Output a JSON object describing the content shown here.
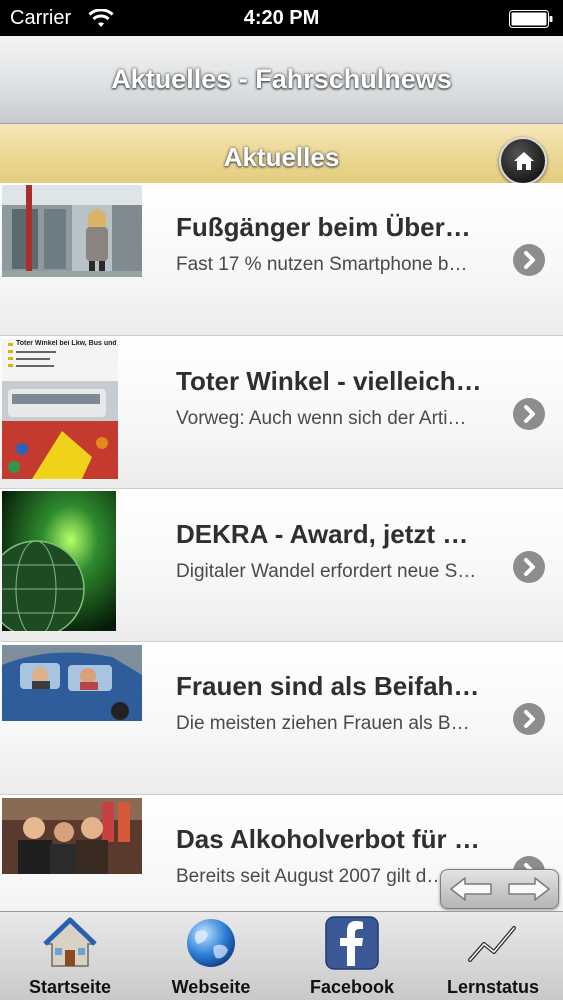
{
  "status_bar": {
    "carrier": "Carrier",
    "time": "4:20 PM"
  },
  "nav": {
    "title": "Aktuelles - Fahrschulnews"
  },
  "section": {
    "title": "Aktuelles"
  },
  "news": [
    {
      "headline": "Fußgänger beim Über…",
      "teaser": "Fast 17 % nutzen Smartphone b…"
    },
    {
      "headline": "Toter Winkel - vielleich…",
      "teaser": "Vorweg: Auch wenn sich der Arti…",
      "thumb_caption": "Toter Winkel bei Lkw, Bus und Pkw"
    },
    {
      "headline": "DEKRA - Award, jetzt …",
      "teaser": "Digitaler Wandel erfordert neue S…"
    },
    {
      "headline": "Frauen sind als Beifah…",
      "teaser": "Die meisten ziehen Frauen als B…"
    },
    {
      "headline": "Das Alkoholverbot für …",
      "teaser": "Bereits seit August 2007 gilt d…"
    }
  ],
  "tabs": [
    {
      "label": "Startseite",
      "icon": "house-icon"
    },
    {
      "label": "Webseite",
      "icon": "globe-icon"
    },
    {
      "label": "Facebook",
      "icon": "facebook-icon"
    },
    {
      "label": "Lernstatus",
      "icon": "chart-line-icon"
    }
  ],
  "colors": {
    "section_gold": "#ecd895",
    "facebook_blue": "#3b5998",
    "chevron_gray": "#8d8d8d"
  }
}
